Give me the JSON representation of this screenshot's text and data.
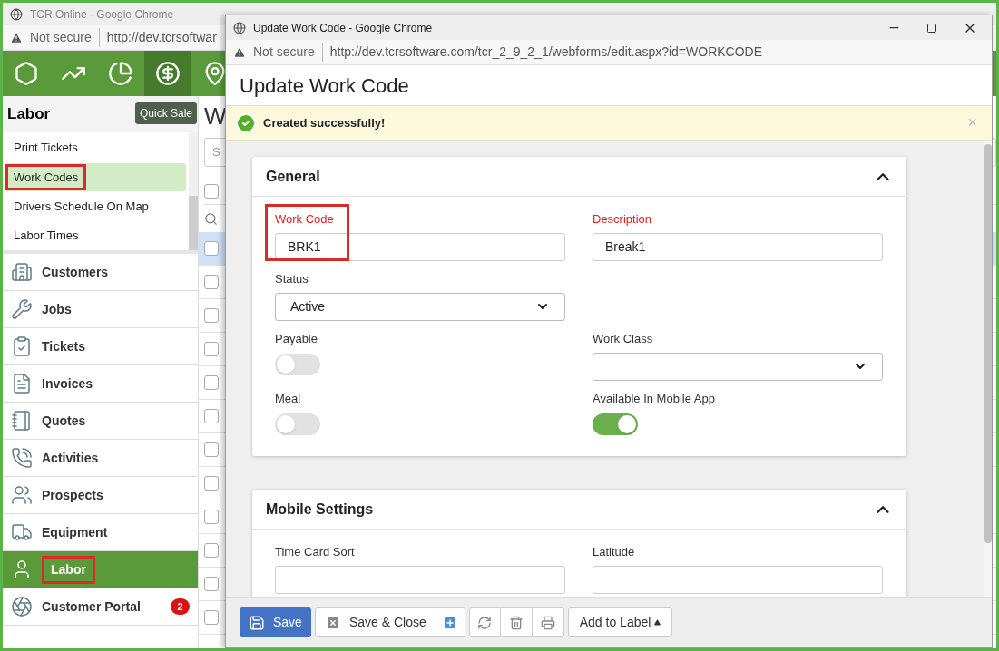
{
  "background_window": {
    "title": "TCR Online - Google Chrome",
    "security": "Not secure",
    "url": "http://dev.tcrsoftwar",
    "top_nav": [
      {
        "kind": "hexagon",
        "selected": false
      },
      {
        "kind": "trend",
        "selected": false
      },
      {
        "kind": "pie",
        "selected": false
      },
      {
        "kind": "dollar",
        "selected": true
      },
      {
        "kind": "map",
        "selected": false
      }
    ],
    "tooltip": "Quick Sale",
    "section_title": "Labor",
    "submenu": [
      {
        "label": "Print Tickets",
        "selected": false,
        "highlighted": false
      },
      {
        "label": "Work Codes",
        "selected": true,
        "highlighted": true
      },
      {
        "label": "Drivers Schedule On Map",
        "selected": false,
        "highlighted": false
      },
      {
        "label": "Labor Times",
        "selected": false,
        "highlighted": false
      }
    ],
    "nav": [
      {
        "label": "Customers",
        "kind": "building",
        "selected": false,
        "highlighted": false
      },
      {
        "label": "Jobs",
        "kind": "tools",
        "selected": false,
        "highlighted": false
      },
      {
        "label": "Tickets",
        "kind": "ticket",
        "selected": false,
        "highlighted": false
      },
      {
        "label": "Invoices",
        "kind": "invoice",
        "selected": false,
        "highlighted": false
      },
      {
        "label": "Quotes",
        "kind": "quote",
        "selected": false,
        "highlighted": false
      },
      {
        "label": "Activities",
        "kind": "phone",
        "selected": false,
        "highlighted": false
      },
      {
        "label": "Prospects",
        "kind": "people",
        "selected": false,
        "highlighted": false
      },
      {
        "label": "Equipment",
        "kind": "truck",
        "selected": false,
        "highlighted": false
      },
      {
        "label": "Labor",
        "kind": "person",
        "selected": true,
        "highlighted": true
      },
      {
        "label": "Customer Portal",
        "kind": "portal",
        "selected": false,
        "highlighted": false,
        "badge": "2"
      }
    ],
    "list_page": {
      "title": "W",
      "search_placeholder": "S",
      "select_all_checked": false,
      "rows": [
        {
          "selected": true,
          "checked": false
        },
        {
          "selected": false,
          "checked": false
        },
        {
          "selected": false,
          "checked": false
        },
        {
          "selected": false,
          "checked": false
        },
        {
          "selected": false,
          "checked": false
        },
        {
          "selected": false,
          "checked": false
        },
        {
          "selected": false,
          "checked": false
        },
        {
          "selected": false,
          "checked": false
        },
        {
          "selected": false,
          "checked": false
        },
        {
          "selected": false,
          "checked": false
        },
        {
          "selected": false,
          "checked": false
        },
        {
          "selected": false,
          "checked": false
        }
      ]
    }
  },
  "dialog": {
    "title": "Update Work Code - Google Chrome",
    "security": "Not secure",
    "url": "http://dev.tcrsoftware.com/tcr_2_9_2_1/webforms/edit.aspx?id=WORKCODE",
    "heading": "Update Work Code",
    "alert": {
      "message": "Created successfully!",
      "close": "×"
    },
    "cards": [
      {
        "title": "General",
        "expanded": true,
        "fields": [
          {
            "kind": "text",
            "label": "Work Code",
            "required": true,
            "highlighted": true,
            "value": "BRK1"
          },
          {
            "kind": "text",
            "label": "Description",
            "required": true,
            "value": "Break1"
          },
          {
            "kind": "select",
            "label": "Status",
            "required": false,
            "value": "Active"
          },
          {
            "kind": "empty"
          },
          {
            "kind": "toggle",
            "label": "Payable",
            "on": false
          },
          {
            "kind": "select",
            "label": "Work Class",
            "required": false
          },
          {
            "kind": "toggle",
            "label": "Meal",
            "on": false
          },
          {
            "kind": "toggle",
            "label": "Available In Mobile App",
            "on": true
          }
        ]
      },
      {
        "title": "Mobile Settings",
        "expanded": true,
        "fields": [
          {
            "kind": "text",
            "label": "Time Card Sort",
            "required": false
          },
          {
            "kind": "text",
            "label": "Latitude",
            "required": false
          }
        ]
      }
    ],
    "footer": {
      "save": "Save",
      "save_close": "Save & Close",
      "add_label": "Add to Label"
    }
  }
}
